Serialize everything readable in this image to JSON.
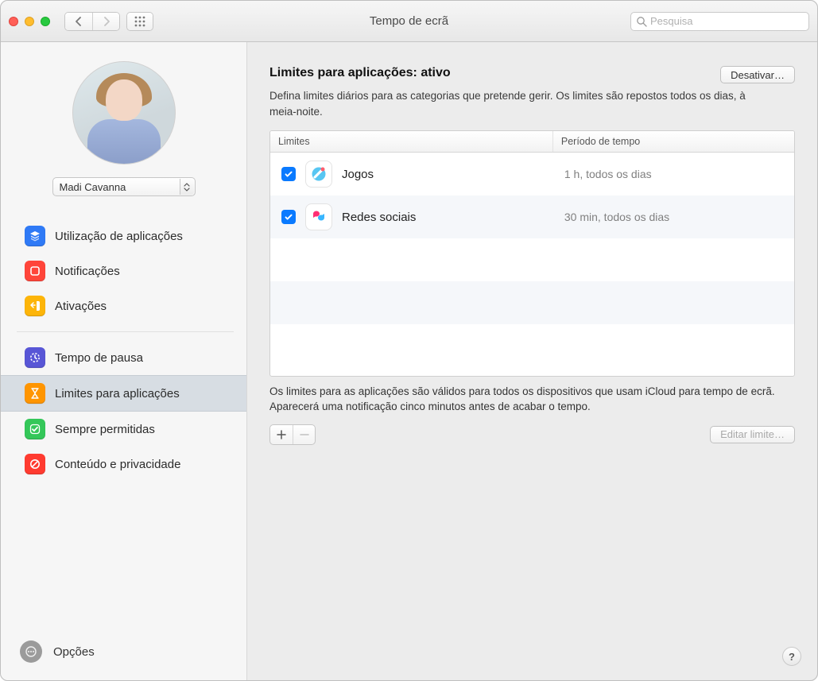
{
  "window": {
    "title": "Tempo de ecrã"
  },
  "search": {
    "placeholder": "Pesquisa"
  },
  "user": {
    "selected": "Madi Cavanna"
  },
  "sidebar": {
    "group1": [
      {
        "label": "Utilização de aplicações"
      },
      {
        "label": "Notificações"
      },
      {
        "label": "Ativações"
      }
    ],
    "group2": [
      {
        "label": "Tempo de pausa"
      },
      {
        "label": "Limites para aplicações"
      },
      {
        "label": "Sempre permitidas"
      },
      {
        "label": "Conteúdo e privacidade"
      }
    ],
    "options": "Opções"
  },
  "main": {
    "heading_prefix": "Limites para aplicações: ",
    "heading_status": "ativo",
    "disable_button": "Desativar…",
    "description": "Defina limites diários para as categorias que pretende gerir. Os limites são repostos todos os dias, à meia-noite.",
    "table": {
      "col_limits": "Limites",
      "col_time": "Período de tempo",
      "rows": [
        {
          "name": "Jogos",
          "time": "1 h, todos os dias"
        },
        {
          "name": "Redes sociais",
          "time": "30 min, todos os dias"
        }
      ]
    },
    "footnote": "Os limites para as aplicações são válidos para todos os dispositivos que usam iCloud para tempo de ecrã. Aparecerá uma notificação cinco minutos antes de acabar o tempo.",
    "edit_button": "Editar limite…"
  }
}
